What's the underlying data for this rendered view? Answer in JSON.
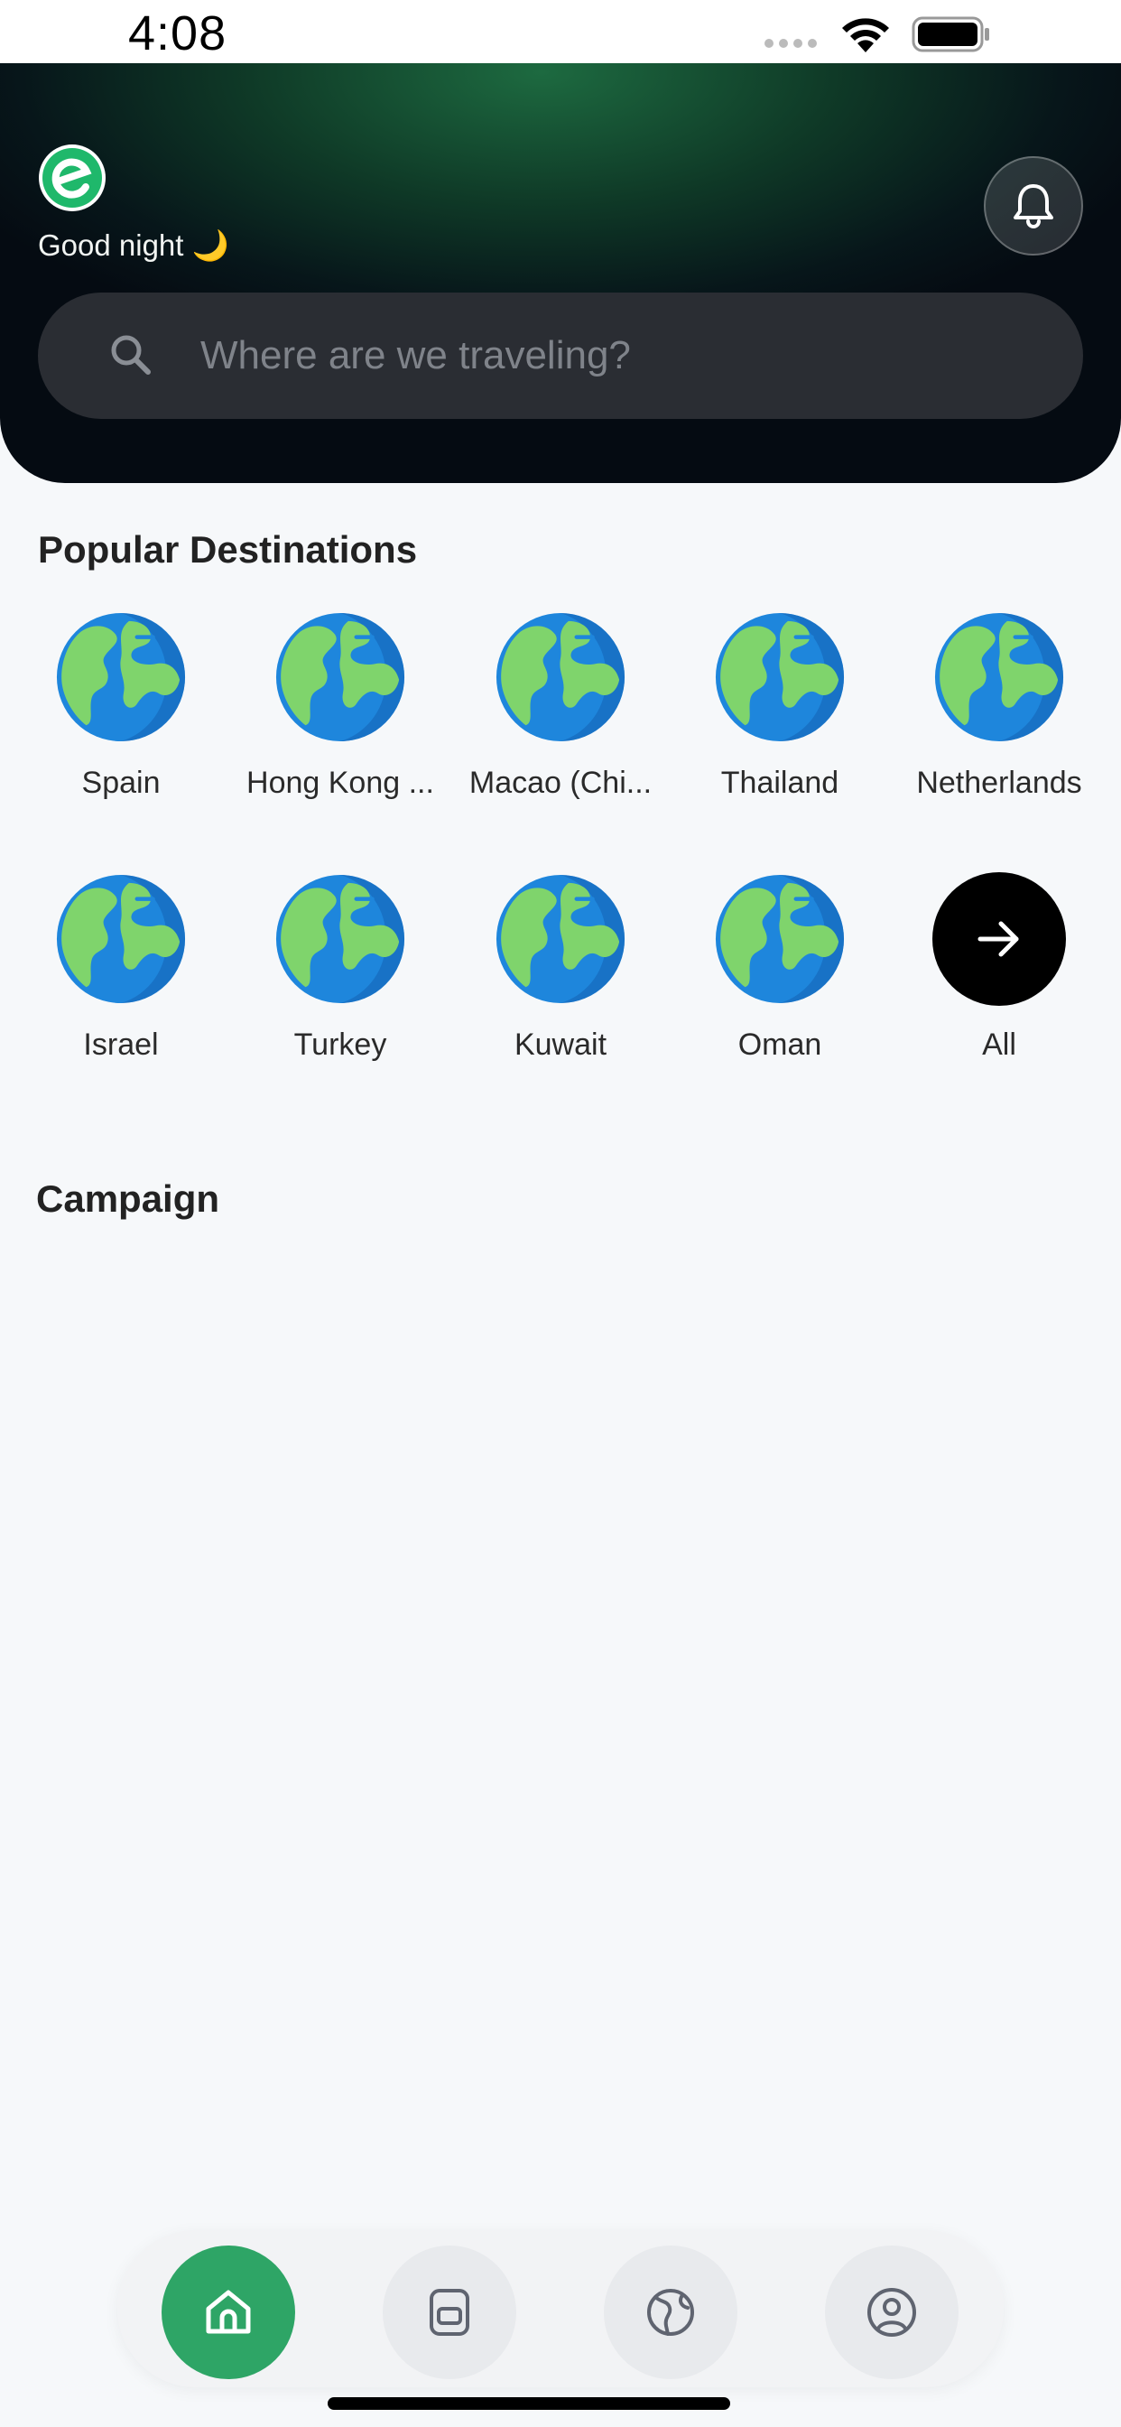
{
  "status_bar": {
    "time": "4:08"
  },
  "header": {
    "greeting": "Good night 🌙",
    "search": {
      "placeholder": "Where are we traveling?"
    }
  },
  "sections": {
    "popular_title": "Popular Destinations",
    "campaign_title": "Campaign"
  },
  "destinations": [
    {
      "label": "Spain",
      "icon": "globe-icon"
    },
    {
      "label": "Hong Kong ...",
      "icon": "globe-icon"
    },
    {
      "label": "Macao (Chi...",
      "icon": "globe-icon"
    },
    {
      "label": "Thailand",
      "icon": "globe-icon"
    },
    {
      "label": "Netherlands",
      "icon": "globe-icon"
    },
    {
      "label": "Israel",
      "icon": "globe-icon"
    },
    {
      "label": "Turkey",
      "icon": "globe-icon"
    },
    {
      "label": "Kuwait",
      "icon": "globe-icon"
    },
    {
      "label": "Oman",
      "icon": "globe-icon"
    },
    {
      "label": "All",
      "icon": "arrow-right-icon"
    }
  ],
  "nav": [
    {
      "name": "home",
      "icon": "home-icon",
      "active": true
    },
    {
      "name": "esims",
      "icon": "sim-card-icon",
      "active": false
    },
    {
      "name": "explore",
      "icon": "globe-outline-icon",
      "active": false
    },
    {
      "name": "profile",
      "icon": "user-circle-icon",
      "active": false
    }
  ],
  "colors": {
    "accent": "#2ea566",
    "logo_green": "#1fb86b",
    "header_dark": "#050b12",
    "search_bg": "#2a2d33"
  }
}
